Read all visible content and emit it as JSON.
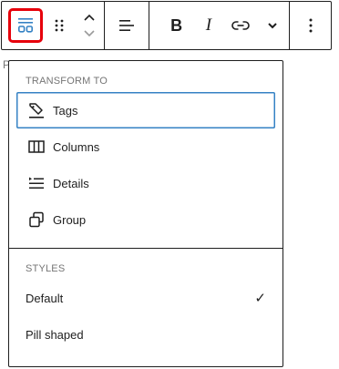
{
  "toolbar": {
    "block_type_icon": "tags-layout-icon",
    "drag_icon": "drag-handle-icon",
    "move_up_icon": "chevron-up-icon",
    "move_down_icon": "chevron-down-icon",
    "align_icon": "justify-left-icon",
    "bold_label": "B",
    "italic_label": "I",
    "link_icon": "link-icon",
    "more_format_icon": "chevron-down-icon",
    "options_icon": "more-vertical-icon",
    "highlight_color": "#e7000b"
  },
  "background_text": "P",
  "menu": {
    "transform_title": "TRANSFORM TO",
    "transform_items": [
      {
        "label": "Tags",
        "icon": "tag-icon"
      },
      {
        "label": "Columns",
        "icon": "columns-icon"
      },
      {
        "label": "Details",
        "icon": "details-icon"
      },
      {
        "label": "Group",
        "icon": "group-icon"
      }
    ],
    "styles_title": "STYLES",
    "style_items": [
      {
        "label": "Default",
        "selected": true
      },
      {
        "label": "Pill shaped",
        "selected": false
      }
    ],
    "check_glyph": "✓",
    "focus_color": "#3582c4"
  }
}
